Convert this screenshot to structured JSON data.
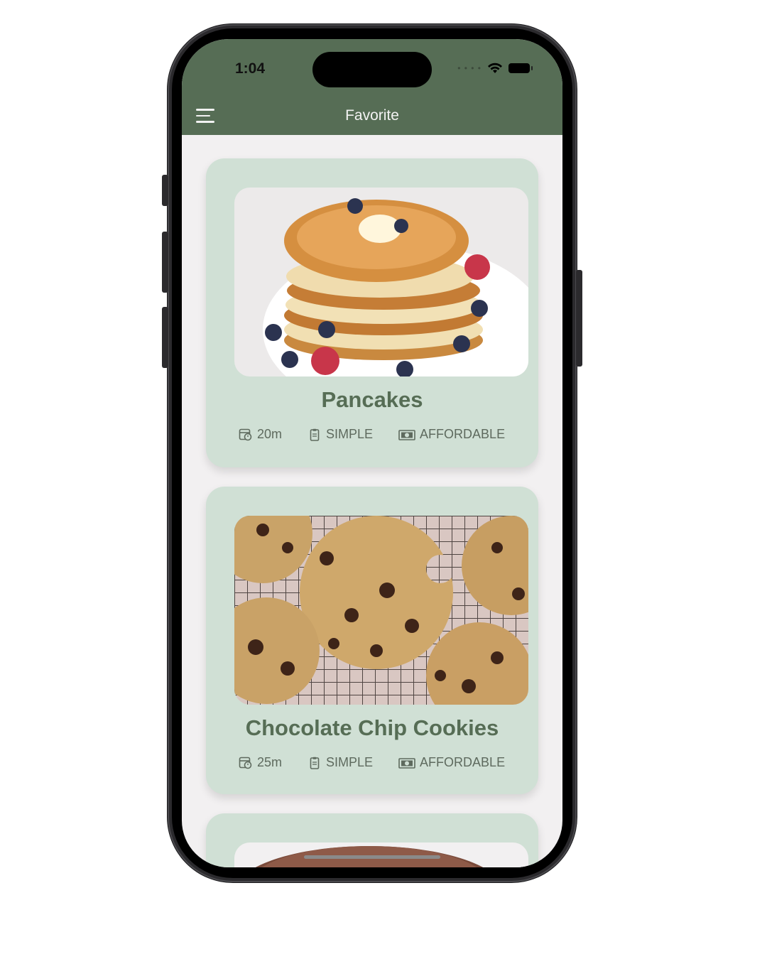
{
  "status_bar": {
    "time": "1:04",
    "signal_icon": "cellular-dots-icon",
    "wifi_icon": "wifi-icon",
    "battery_icon": "battery-icon"
  },
  "header": {
    "title": "Favorite",
    "menu_icon": "hamburger-menu-icon"
  },
  "colors": {
    "header_bg": "#566d55",
    "card_bg": "#d0e0d5",
    "title_color": "#566d55",
    "screen_bg": "#f2f0f1"
  },
  "meals": [
    {
      "title": "Pancakes",
      "duration": "20m",
      "complexity": "SIMPLE",
      "affordability": "AFFORDABLE",
      "image": "pancakes-photo"
    },
    {
      "title": "Chocolate Chip Cookies",
      "duration": "25m",
      "complexity": "SIMPLE",
      "affordability": "AFFORDABLE",
      "image": "chocolate-chip-cookies-photo"
    },
    {
      "image": "third-meal-photo"
    }
  ]
}
